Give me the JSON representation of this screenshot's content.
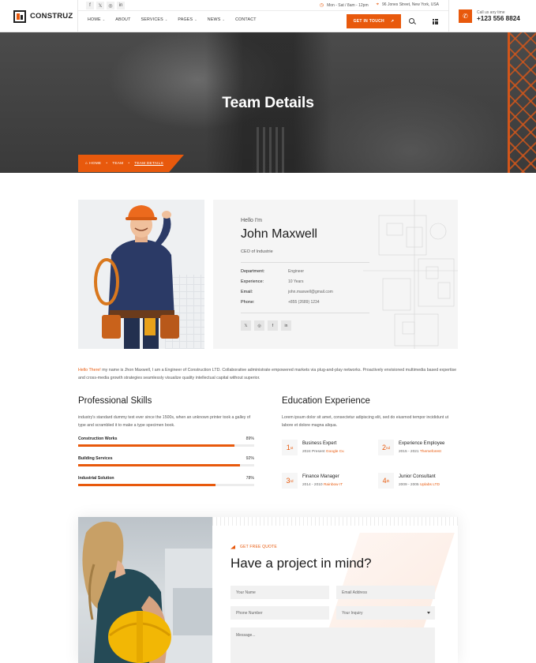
{
  "header": {
    "logo_text": "CONSTRUZ",
    "social": [
      "f",
      "𝕏",
      "◎",
      "in"
    ],
    "hours": "Mon - Sat / 8am - 12pm",
    "address": "96 Jones Street, New York, USA",
    "nav": [
      {
        "label": "HOME",
        "dropdown": true
      },
      {
        "label": "ABOUT",
        "dropdown": false
      },
      {
        "label": "SERVICES",
        "dropdown": true
      },
      {
        "label": "PAGES",
        "dropdown": true
      },
      {
        "label": "NEWS",
        "dropdown": true
      },
      {
        "label": "CONTACT",
        "dropdown": false
      }
    ],
    "cta_label": "GET IN TOUCH",
    "call_label": "Call us any time",
    "call_number": "+123 556 8824"
  },
  "hero": {
    "title": "Team Details",
    "breadcrumb": [
      "HOME",
      "TEAM",
      "TEAM DETAILS"
    ]
  },
  "profile": {
    "hello": "Hello I'm",
    "name": "John Maxwell",
    "role": "CEO of Industrie",
    "details": [
      {
        "label": "Department:",
        "value": "Engineer"
      },
      {
        "label": "Experience:",
        "value": "10 Years"
      },
      {
        "label": "Email:",
        "value": "john.maxwell@gmail.com"
      },
      {
        "label": "Phone:",
        "value": "+855 (2689) 1234"
      }
    ],
    "social": [
      "𝕏",
      "◎",
      "f",
      "in"
    ],
    "bio_lead": "Hello There!",
    "bio": " my name is Jhon Maxwell, I am a Engineer of Construction LTD. Collaborative administrate empowered markets via plug-and-play networks. Proactively envisioned multimedia based expertise and cross-media growth strategies seamlessly visualize quality intellectual capital without superior."
  },
  "skills": {
    "title": "Professional Skills",
    "text": "industry's standard dummy text ever since the 1500s, when an unknown printer took a galley of type and scrambled it to make a type specimen book.",
    "items": [
      {
        "name": "Construction Works",
        "percent_label": "89%",
        "value": 89
      },
      {
        "name": "Building Services",
        "percent_label": "92%",
        "value": 92
      },
      {
        "name": "Industrial Solution",
        "percent_label": "78%",
        "value": 78
      }
    ]
  },
  "education": {
    "title": "Education Experience",
    "text": "Lorem ipsum dolor sit amet, consectetur adipiscing elit, sed do eiusmod tempor incididunt ut labore et dolore magna aliqua.",
    "items": [
      {
        "num": "1",
        "suffix": "st",
        "title": "Business Expert",
        "years": "2024 Present",
        "org": "Google Cv."
      },
      {
        "num": "2",
        "suffix": "nd",
        "title": "Experience Employee",
        "years": "2015 - 2021",
        "org": "Themeforest"
      },
      {
        "num": "3",
        "suffix": "rd",
        "title": "Finance Manager",
        "years": "2014 - 2010",
        "org": "Rainbow IT"
      },
      {
        "num": "4",
        "suffix": "th",
        "title": "Junior Consultant",
        "years": "2009 - 2005",
        "org": "Uplabs LTD"
      }
    ]
  },
  "quote": {
    "label": "GET FREE QUOTE",
    "title": "Have a project in mind?",
    "fields": {
      "name": "Your Name",
      "email": "Email Address",
      "phone": "Phone Number",
      "inquiry": "Your Inquiry",
      "message": "Message..."
    }
  },
  "colors": {
    "accent": "#e8590c",
    "dark": "#1b1b1b"
  }
}
